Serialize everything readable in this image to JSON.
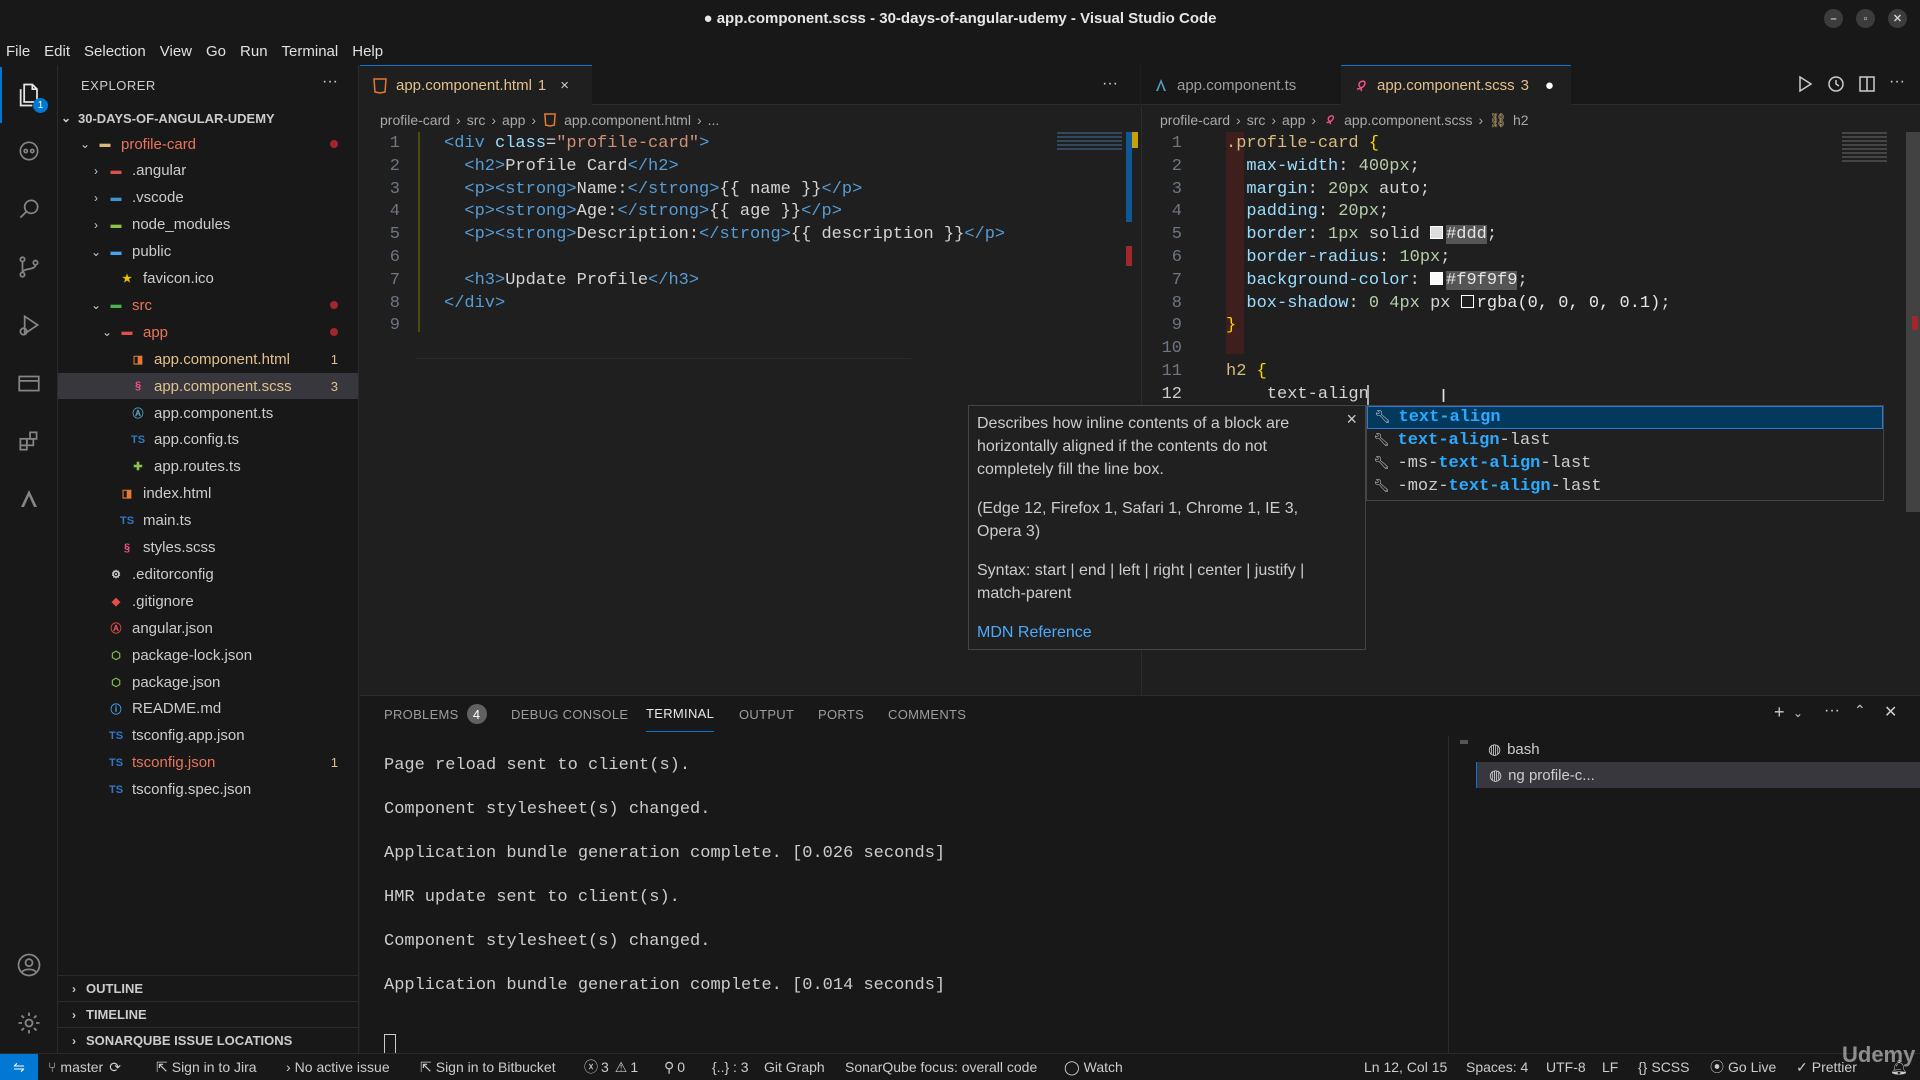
{
  "window": {
    "title": "● app.component.scss - 30-days-of-angular-udemy - Visual Studio Code"
  },
  "menu": [
    "File",
    "Edit",
    "Selection",
    "View",
    "Go",
    "Run",
    "Terminal",
    "Help"
  ],
  "activity": {
    "explorer_badge": "1",
    "icons": [
      "files-icon",
      "copilot-icon",
      "search-icon",
      "source-control-icon",
      "run-debug-icon",
      "remote-explorer-icon",
      "extensions-icon",
      "angular-icon",
      "account-icon",
      "settings-gear-icon"
    ]
  },
  "sidebar": {
    "title": "EXPLORER",
    "root": "30-DAYS-OF-ANGULAR-UDEMY",
    "items": [
      {
        "label": "profile-card",
        "icon": "folder",
        "color": "#e8745b",
        "indent": 1,
        "chev": "v",
        "dot": true
      },
      {
        "label": ".angular",
        "icon": "folder-angular",
        "color": "#ccc",
        "indent": 2,
        "chev": ">"
      },
      {
        "label": ".vscode",
        "icon": "folder-vscode",
        "color": "#ccc",
        "indent": 2,
        "chev": ">"
      },
      {
        "label": "node_modules",
        "icon": "folder-node",
        "color": "#ccc",
        "indent": 2,
        "chev": ">"
      },
      {
        "label": "public",
        "icon": "folder-public",
        "color": "#ccc",
        "indent": 2,
        "chev": "v"
      },
      {
        "label": "favicon.ico",
        "icon": "star",
        "color": "#ccc",
        "indent": 3
      },
      {
        "label": "src",
        "icon": "folder-src",
        "color": "#e8745b",
        "indent": 2,
        "chev": "v",
        "dot": true
      },
      {
        "label": "app",
        "icon": "folder-app",
        "color": "#e8745b",
        "indent": 3,
        "chev": "v",
        "dot": true
      },
      {
        "label": "app.component.html",
        "icon": "html",
        "color": "#e2c08d",
        "indent": 4,
        "badge": "1"
      },
      {
        "label": "app.component.scss",
        "icon": "scss",
        "color": "#e2c08d",
        "indent": 4,
        "badge": "3",
        "selected": true
      },
      {
        "label": "app.component.ts",
        "icon": "ts-angular",
        "color": "#ccc",
        "indent": 4
      },
      {
        "label": "app.config.ts",
        "icon": "ts",
        "color": "#ccc",
        "indent": 4
      },
      {
        "label": "app.routes.ts",
        "icon": "routes",
        "color": "#ccc",
        "indent": 4
      },
      {
        "label": "index.html",
        "icon": "html",
        "color": "#ccc",
        "indent": 3
      },
      {
        "label": "main.ts",
        "icon": "ts",
        "color": "#ccc",
        "indent": 3
      },
      {
        "label": "styles.scss",
        "icon": "scss",
        "color": "#ccc",
        "indent": 3
      },
      {
        "label": ".editorconfig",
        "icon": "editorconfig",
        "color": "#ccc",
        "indent": 2
      },
      {
        "label": ".gitignore",
        "icon": "git",
        "color": "#ccc",
        "indent": 2
      },
      {
        "label": "angular.json",
        "icon": "angular",
        "color": "#ccc",
        "indent": 2
      },
      {
        "label": "package-lock.json",
        "icon": "node",
        "color": "#ccc",
        "indent": 2
      },
      {
        "label": "package.json",
        "icon": "node",
        "color": "#ccc",
        "indent": 2
      },
      {
        "label": "README.md",
        "icon": "info",
        "color": "#ccc",
        "indent": 2
      },
      {
        "label": "tsconfig.app.json",
        "icon": "tsconfig",
        "color": "#ccc",
        "indent": 2
      },
      {
        "label": "tsconfig.json",
        "icon": "tsconfig",
        "color": "#e8745b",
        "indent": 2,
        "badge": "1"
      },
      {
        "label": "tsconfig.spec.json",
        "icon": "tsconfig",
        "color": "#ccc",
        "indent": 2
      }
    ],
    "sections": [
      "OUTLINE",
      "TIMELINE",
      "SONARQUBE ISSUE LOCATIONS"
    ]
  },
  "left_editor": {
    "tab": {
      "label": "app.component.html",
      "badge": "1",
      "close": "×"
    },
    "more": "···",
    "breadcrumb": [
      "profile-card",
      "src",
      "app",
      "app.component.html",
      "..."
    ],
    "line_numbers": [
      "1",
      "2",
      "3",
      "4",
      "5",
      "6",
      "7",
      "8",
      "9"
    ]
  },
  "right_editor": {
    "tabs": [
      {
        "label": "app.component.ts"
      },
      {
        "label": "app.component.scss",
        "badge": "3",
        "dirty": "●"
      }
    ],
    "breadcrumb": [
      "profile-card",
      "src",
      "app",
      "app.component.scss",
      "h2"
    ],
    "line_numbers": [
      "1",
      "2",
      "3",
      "4",
      "5",
      "6",
      "7",
      "8",
      "9",
      "10",
      "11",
      "12"
    ]
  },
  "code_html": [
    [
      [
        "tg",
        "<div "
      ],
      [
        "at",
        "class"
      ],
      [
        "tx",
        "="
      ],
      [
        "st",
        "\"profile-card\""
      ],
      [
        "tg",
        ">"
      ]
    ],
    [
      [
        "tx",
        "  "
      ],
      [
        "tg",
        "<h2>"
      ],
      [
        "tx",
        "Profile Card"
      ],
      [
        "tg",
        "</h2>"
      ]
    ],
    [
      [
        "tx",
        "  "
      ],
      [
        "tg",
        "<p><strong>"
      ],
      [
        "tx",
        "Name:"
      ],
      [
        "tg",
        "</strong>"
      ],
      [
        "tx",
        "{{ name }}"
      ],
      [
        "tg",
        "</p>"
      ]
    ],
    [
      [
        "tx",
        "  "
      ],
      [
        "tg",
        "<p><strong>"
      ],
      [
        "tx",
        "Age:"
      ],
      [
        "tg",
        "</strong>"
      ],
      [
        "tx",
        "{{ age }}"
      ],
      [
        "tg",
        "</p>"
      ]
    ],
    [
      [
        "tx",
        "  "
      ],
      [
        "tg",
        "<p><strong>"
      ],
      [
        "tx",
        "Description:"
      ],
      [
        "tg",
        "</strong>"
      ],
      [
        "tx",
        "{{ description }}"
      ],
      [
        "tg",
        "</p>"
      ]
    ],
    [
      [
        "tx",
        ""
      ]
    ],
    [
      [
        "tx",
        "  "
      ],
      [
        "tg",
        "<h3>"
      ],
      [
        "tx",
        "Update Profile"
      ],
      [
        "tg",
        "</h3>"
      ]
    ],
    [
      [
        "tg",
        "</div>"
      ]
    ],
    [
      [
        "tx",
        ""
      ]
    ]
  ],
  "code_scss": [
    [
      [
        "sel-c",
        ".profile-card "
      ],
      [
        "yb",
        "{"
      ]
    ],
    [
      [
        "tx",
        "  "
      ],
      [
        "pr",
        "max-width"
      ],
      [
        "pu",
        ": "
      ],
      [
        "nu",
        "400px"
      ],
      [
        "pu",
        ";"
      ]
    ],
    [
      [
        "tx",
        "  "
      ],
      [
        "pr",
        "margin"
      ],
      [
        "pu",
        ": "
      ],
      [
        "nu",
        "20px "
      ],
      [
        "tx",
        "auto"
      ],
      [
        "pu",
        ";"
      ]
    ],
    [
      [
        "tx",
        "  "
      ],
      [
        "pr",
        "padding"
      ],
      [
        "pu",
        ": "
      ],
      [
        "nu",
        "20px"
      ],
      [
        "pu",
        ";"
      ]
    ],
    [
      [
        "tx",
        "  "
      ],
      [
        "pr",
        "border"
      ],
      [
        "pu",
        ": "
      ],
      [
        "nu",
        "1px "
      ],
      [
        "tx",
        "solid "
      ],
      [
        "sw",
        "#ddd"
      ],
      [
        "pu",
        ";"
      ]
    ],
    [
      [
        "tx",
        "  "
      ],
      [
        "pr",
        "border-radius"
      ],
      [
        "pu",
        ": "
      ],
      [
        "nu",
        "10px"
      ],
      [
        "pu",
        ";"
      ]
    ],
    [
      [
        "tx",
        "  "
      ],
      [
        "pr",
        "background-color"
      ],
      [
        "pu",
        ": "
      ],
      [
        "sw",
        "#f9f9f9"
      ],
      [
        "pu",
        ";"
      ]
    ],
    [
      [
        "tx",
        "  "
      ],
      [
        "pr",
        "box-shadow"
      ],
      [
        "pu",
        ": "
      ],
      [
        "nu",
        "0 4px "
      ],
      [
        "tx",
        "px "
      ],
      [
        "swr",
        "rgba(0, 0, 0, 0.1)"
      ],
      [
        "pu",
        ";"
      ]
    ],
    [
      [
        "yb",
        "}"
      ]
    ],
    [
      [
        "tx",
        ""
      ]
    ],
    [
      [
        "sel-c",
        "h2 "
      ],
      [
        "yb",
        "{"
      ]
    ],
    [
      [
        "tx",
        "    "
      ],
      [
        "tx",
        "text-align"
      ]
    ]
  ],
  "hover": {
    "description": "Describes how inline contents of a block are horizontally aligned if the contents do not completely fill the line box.",
    "compat": "(Edge 12, Firefox 1, Safari 1, Chrome 1, IE 3, Opera 3)",
    "syntax": "Syntax: start | end | left | right | center | justify | match-parent",
    "link": "MDN Reference",
    "close": "×"
  },
  "suggestions": [
    {
      "pre": "",
      "hl": "text-align",
      "post": ""
    },
    {
      "pre": "",
      "hl": "text-align",
      "post": "-last"
    },
    {
      "pre": "-ms-",
      "hl": "text-align",
      "post": "-last"
    },
    {
      "pre": "-moz-",
      "hl": "text-align",
      "post": "-last"
    }
  ],
  "panel": {
    "tabs": [
      "PROBLEMS",
      "DEBUG CONSOLE",
      "TERMINAL",
      "OUTPUT",
      "PORTS",
      "COMMENTS"
    ],
    "problems_count": "4",
    "terminal_lines": [
      "Page reload sent to client(s).",
      "Component stylesheet(s) changed.",
      "Application bundle generation complete. [0.026 seconds]",
      "HMR update sent to client(s).",
      "Component stylesheet(s) changed.",
      "Application bundle generation complete. [0.014 seconds]"
    ],
    "terminals": [
      {
        "label": "bash"
      },
      {
        "label": "ng  profile-c..."
      }
    ]
  },
  "status": {
    "branch": "master",
    "jira": "Sign in to Jira",
    "issue": "No active issue",
    "bitbucket": "Sign in to Bitbucket",
    "errors": "3",
    "warnings": "1",
    "ports": "0",
    "braces": "{..} : 3",
    "gitgraph": "Git Graph",
    "sonar": "SonarQube focus: overall code",
    "watch": "Watch",
    "position": "Ln 12, Col 15",
    "spaces": "Spaces: 4",
    "encoding": "UTF-8",
    "eol": "LF",
    "language": "SCSS",
    "golive": "Go Live",
    "prettier": "Prettier"
  },
  "watermark": "Udemy"
}
